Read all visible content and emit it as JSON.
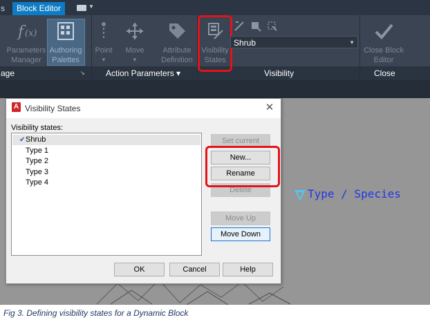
{
  "tabs": {
    "left_partial": "s",
    "active": "Block Editor"
  },
  "ribbon": {
    "buttons": [
      {
        "label": "Parameters Manager",
        "icon": "fx-icon"
      },
      {
        "label": "Authoring Palettes",
        "icon": "palette-grid-icon"
      },
      {
        "label": "Point",
        "icon": "point-parameter-icon"
      },
      {
        "label": "Move",
        "icon": "move-arrows-icon"
      },
      {
        "label": "Attribute Definition",
        "icon": "tag-icon"
      },
      {
        "label": "Visibility States",
        "icon": "visibility-states-icon"
      },
      {
        "label": "Close Block Editor",
        "icon": "checkmark-icon"
      }
    ],
    "visibility_combo": "Shrub",
    "panels": {
      "manage_partial": "age",
      "action_parameters": "Action Parameters ▾",
      "visibility": "Visibility",
      "close": "Close"
    }
  },
  "canvas": {
    "annotation_text": "Type / Species"
  },
  "dialog": {
    "title": "Visibility States",
    "list_label": "Visibility states:",
    "states": [
      {
        "label": "Shrub",
        "current": true
      },
      {
        "label": "Type 1",
        "current": false
      },
      {
        "label": "Type 2",
        "current": false
      },
      {
        "label": "Type 3",
        "current": false
      },
      {
        "label": "Type 4",
        "current": false
      }
    ],
    "buttons": {
      "set_current": "Set current",
      "new": "New...",
      "rename": "Rename",
      "delete": "Delete",
      "move_up": "Move Up",
      "move_down": "Move Down",
      "ok": "OK",
      "cancel": "Cancel",
      "help": "Help"
    }
  },
  "caption": "Fig 3. Defining visibility states for a Dynamic Block",
  "colors": {
    "highlight": "#e3131b",
    "tab_active": "#0d7cc4",
    "annotation_text": "#2036e6",
    "annotation_triangle": "#57c4f0"
  }
}
